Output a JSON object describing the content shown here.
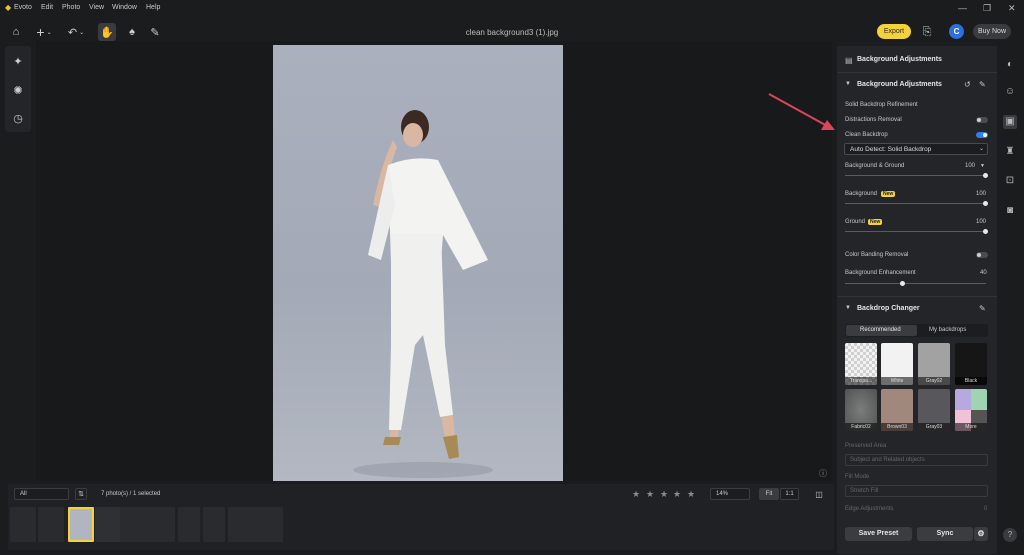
{
  "menu": {
    "app": "Evoto",
    "items": [
      "Edit",
      "Photo",
      "View",
      "Window",
      "Help"
    ]
  },
  "title": "clean background3 (1).jpg",
  "topbar": {
    "export_label": "Export",
    "avatar_letter": "C",
    "buy_label": "Buy Now"
  },
  "filmstrip": {
    "filter_value": "All",
    "count_text": "7 photo(s) / 1 selected",
    "zoom_value": "14%",
    "fit_label": "Fit",
    "one_label": "1:1"
  },
  "panel": {
    "header": "Background Adjustments",
    "section_bg": "Background Adjustments",
    "solid_refine": "Solid Backdrop Refinement",
    "distractions": "Distractions Removal",
    "clean_backdrop": "Clean Backdrop",
    "detect_value": "Auto Detect: Solid Backdrop",
    "bg_ground": {
      "label": "Background & Ground",
      "value": "100"
    },
    "background": {
      "label": "Background",
      "value": "100",
      "badge": "New"
    },
    "ground": {
      "label": "Ground",
      "value": "100",
      "badge": "New"
    },
    "color_banding": "Color Banding Removal",
    "bg_enhance": {
      "label": "Background Enhancement",
      "value": "40"
    },
    "changer": "Backdrop Changer",
    "tab_recommended": "Recommended",
    "tab_mine": "My backdrops",
    "swatches": [
      {
        "label": "Transpa...",
        "color": "#e6e6e6"
      },
      {
        "label": "White",
        "color": "#f2f2f2"
      },
      {
        "label": "Gray02",
        "color": "#a2a2a2"
      },
      {
        "label": "Black",
        "color": "#161616"
      },
      {
        "label": "Fabric02",
        "color": "#6b6e6c"
      },
      {
        "label": "Brown03",
        "color": "#a0887c"
      },
      {
        "label": "Gray03",
        "color": "#58585c"
      },
      {
        "label": "More",
        "color": "#9fa0b8"
      }
    ],
    "preserved_area": "Preserved Area",
    "preserved_value": "Subject and Related objects",
    "fill_mode": "Fill Mode",
    "fill_value": "Stretch Fill",
    "edge_adjust": "Edge Adjustments",
    "edge_value": "0",
    "save_preset": "Save Preset",
    "sync": "Sync"
  },
  "colors": {
    "accent": "#f4d33a",
    "toggle_on": "#2e7cf6",
    "arrow": "#e0445a"
  }
}
